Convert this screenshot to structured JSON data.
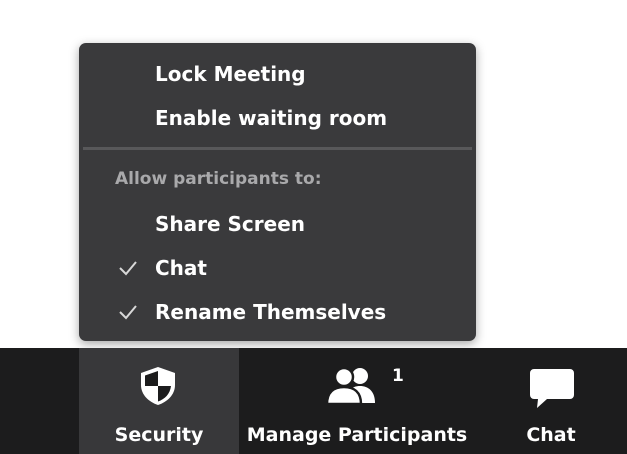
{
  "security_menu": {
    "items": [
      {
        "label": "Lock Meeting",
        "checked": false
      },
      {
        "label": "Enable waiting room",
        "checked": false
      }
    ],
    "section_header": "Allow participants to:",
    "permissions": [
      {
        "label": "Share Screen",
        "checked": false
      },
      {
        "label": "Chat",
        "checked": true
      },
      {
        "label": "Rename Themselves",
        "checked": true
      }
    ]
  },
  "toolbar": {
    "security": {
      "label": "Security",
      "icon": "shield-icon"
    },
    "participants": {
      "label": "Manage Participants",
      "count": "1",
      "icon": "participants-icon"
    },
    "chat": {
      "label": "Chat",
      "icon": "chat-bubble-icon"
    }
  },
  "colors": {
    "menu_bg": "#3a3a3c",
    "toolbar_bg": "#1c1c1d",
    "toolbar_active": "#38383a",
    "section_text": "#a9a9ab"
  }
}
